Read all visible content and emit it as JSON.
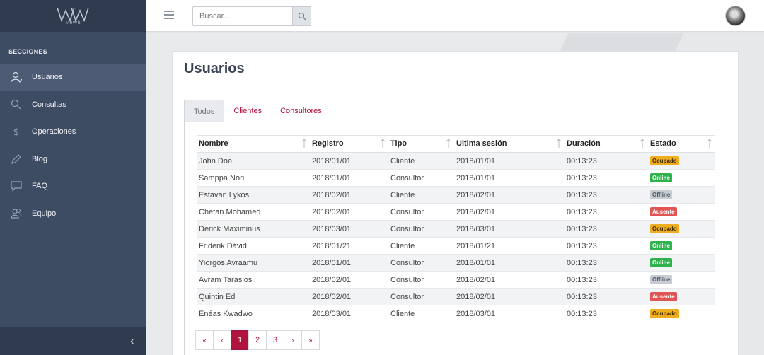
{
  "brand": {
    "logo_text": "MW",
    "logo_sub": "MeWit"
  },
  "sidebar": {
    "section_title": "SECCIONES",
    "items": [
      {
        "label": "Usuarios",
        "icon": "user-icon",
        "active": true
      },
      {
        "label": "Consultas",
        "icon": "search-icon",
        "active": false
      },
      {
        "label": "Operaciones",
        "icon": "dollar-icon",
        "active": false
      },
      {
        "label": "Blog",
        "icon": "pencil-icon",
        "active": false
      },
      {
        "label": "FAQ",
        "icon": "chat-icon",
        "active": false
      },
      {
        "label": "Equipo",
        "icon": "users-icon",
        "active": false
      }
    ],
    "collapse_symbol": "‹"
  },
  "topbar": {
    "search_placeholder": "Buscar..."
  },
  "page": {
    "title": "Usuarios"
  },
  "tabs": [
    {
      "label": "Todos",
      "active": true
    },
    {
      "label": "Clientes",
      "active": false
    },
    {
      "label": "Consultores",
      "active": false
    }
  ],
  "table": {
    "columns": [
      "Nombre",
      "Registro",
      "Tipo",
      "Ultima sesión",
      "Duración",
      "Estado"
    ],
    "rows": [
      {
        "nombre": "John Doe",
        "registro": "2018/01/01",
        "tipo": "Cliente",
        "ultima": "2018/01/01",
        "duracion": "00:13:23",
        "estado": "Ocupado"
      },
      {
        "nombre": "Samppa Nori",
        "registro": "2018/01/01",
        "tipo": "Consultor",
        "ultima": "2018/01/01",
        "duracion": "00:13:23",
        "estado": "Online"
      },
      {
        "nombre": "Estavan Lykos",
        "registro": "2018/02/01",
        "tipo": "Cliente",
        "ultima": "2018/02/01",
        "duracion": "00:13:23",
        "estado": "Offline"
      },
      {
        "nombre": "Chetan Mohamed",
        "registro": "2018/02/01",
        "tipo": "Consultor",
        "ultima": "2018/02/01",
        "duracion": "00:13:23",
        "estado": "Ausente"
      },
      {
        "nombre": "Derick Maximinus",
        "registro": "2018/03/01",
        "tipo": "Consultor",
        "ultima": "2018/03/01",
        "duracion": "00:13:23",
        "estado": "Ocupado"
      },
      {
        "nombre": "Friderik Dávid",
        "registro": "2018/01/21",
        "tipo": "Cliente",
        "ultima": "2018/01/21",
        "duracion": "00:13:23",
        "estado": "Online"
      },
      {
        "nombre": "Yiorgos Avraamu",
        "registro": "2018/01/01",
        "tipo": "Consultor",
        "ultima": "2018/01/01",
        "duracion": "00:13:23",
        "estado": "Online"
      },
      {
        "nombre": "Avram Tarasios",
        "registro": "2018/02/01",
        "tipo": "Consultor",
        "ultima": "2018/02/01",
        "duracion": "00:13:23",
        "estado": "Offline"
      },
      {
        "nombre": "Quintin Ed",
        "registro": "2018/02/01",
        "tipo": "Consultor",
        "ultima": "2018/02/01",
        "duracion": "00:13:23",
        "estado": "Ausente"
      },
      {
        "nombre": "Enéas Kwadwo",
        "registro": "2018/03/01",
        "tipo": "Cliente",
        "ultima": "2018/03/01",
        "duracion": "00:13:23",
        "estado": "Ocupado"
      }
    ]
  },
  "pagination": {
    "first": "«",
    "prev": "‹",
    "pages": [
      "1",
      "2",
      "3"
    ],
    "active_page": "1",
    "next": "›",
    "last": "»"
  },
  "colors": {
    "accent": "#b0133d",
    "sidebar_bg": "#3e4c63",
    "ocupado": "#f0ad1e",
    "online": "#2db24c",
    "offline": "#c7ccd3",
    "ausente": "#e05454"
  }
}
